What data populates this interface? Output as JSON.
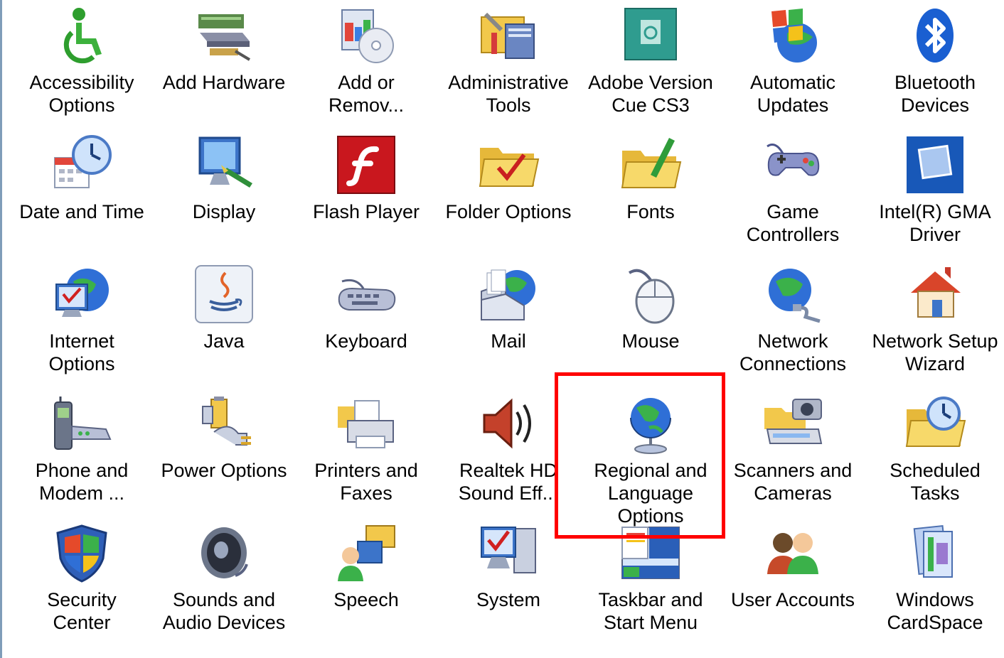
{
  "items": [
    {
      "label": "Accessibility\nOptions",
      "icon": "accessibility-icon"
    },
    {
      "label": "Add Hardware",
      "icon": "add-hardware-icon"
    },
    {
      "label": "Add or\nRemov...",
      "icon": "add-remove-programs-icon"
    },
    {
      "label": "Administrative\nTools",
      "icon": "administrative-tools-icon"
    },
    {
      "label": "Adobe Version\nCue CS3",
      "icon": "adobe-version-cue-icon"
    },
    {
      "label": "Automatic\nUpdates",
      "icon": "automatic-updates-icon"
    },
    {
      "label": "Bluetooth\nDevices",
      "icon": "bluetooth-icon"
    },
    {
      "label": "Date and Time",
      "icon": "date-time-icon"
    },
    {
      "label": "Display",
      "icon": "display-icon"
    },
    {
      "label": "Flash Player",
      "icon": "flash-player-icon"
    },
    {
      "label": "Folder Options",
      "icon": "folder-options-icon"
    },
    {
      "label": "Fonts",
      "icon": "fonts-folder-icon"
    },
    {
      "label": "Game\nControllers",
      "icon": "game-controller-icon"
    },
    {
      "label": "Intel(R) GMA\nDriver",
      "icon": "intel-gma-icon"
    },
    {
      "label": "Internet\nOptions",
      "icon": "internet-options-icon"
    },
    {
      "label": "Java",
      "icon": "java-icon"
    },
    {
      "label": "Keyboard",
      "icon": "keyboard-icon"
    },
    {
      "label": "Mail",
      "icon": "mail-icon"
    },
    {
      "label": "Mouse",
      "icon": "mouse-icon"
    },
    {
      "label": "Network\nConnections",
      "icon": "network-connections-icon"
    },
    {
      "label": "Network Setup\nWizard",
      "icon": "network-setup-icon"
    },
    {
      "label": "Phone and\nModem ...",
      "icon": "phone-modem-icon"
    },
    {
      "label": "Power Options",
      "icon": "power-options-icon"
    },
    {
      "label": "Printers and\nFaxes",
      "icon": "printer-icon"
    },
    {
      "label": "Realtek HD\nSound Eff...",
      "icon": "speaker-icon"
    },
    {
      "label": "Regional and\nLanguage\nOptions",
      "icon": "globe-icon"
    },
    {
      "label": "Scanners and\nCameras",
      "icon": "scanner-camera-icon"
    },
    {
      "label": "Scheduled\nTasks",
      "icon": "scheduled-tasks-icon"
    },
    {
      "label": "Security\nCenter",
      "icon": "security-shield-icon"
    },
    {
      "label": "Sounds and\nAudio Devices",
      "icon": "sounds-audio-icon"
    },
    {
      "label": "Speech",
      "icon": "speech-icon"
    },
    {
      "label": "System",
      "icon": "system-icon"
    },
    {
      "label": "Taskbar and\nStart Menu",
      "icon": "taskbar-icon"
    },
    {
      "label": "User Accounts",
      "icon": "user-accounts-icon"
    },
    {
      "label": "Windows\nCardSpace",
      "icon": "cardspace-icon"
    }
  ],
  "highlight": {
    "target": "Regional and\nLanguage\nOptions",
    "color": "#ff0000"
  }
}
